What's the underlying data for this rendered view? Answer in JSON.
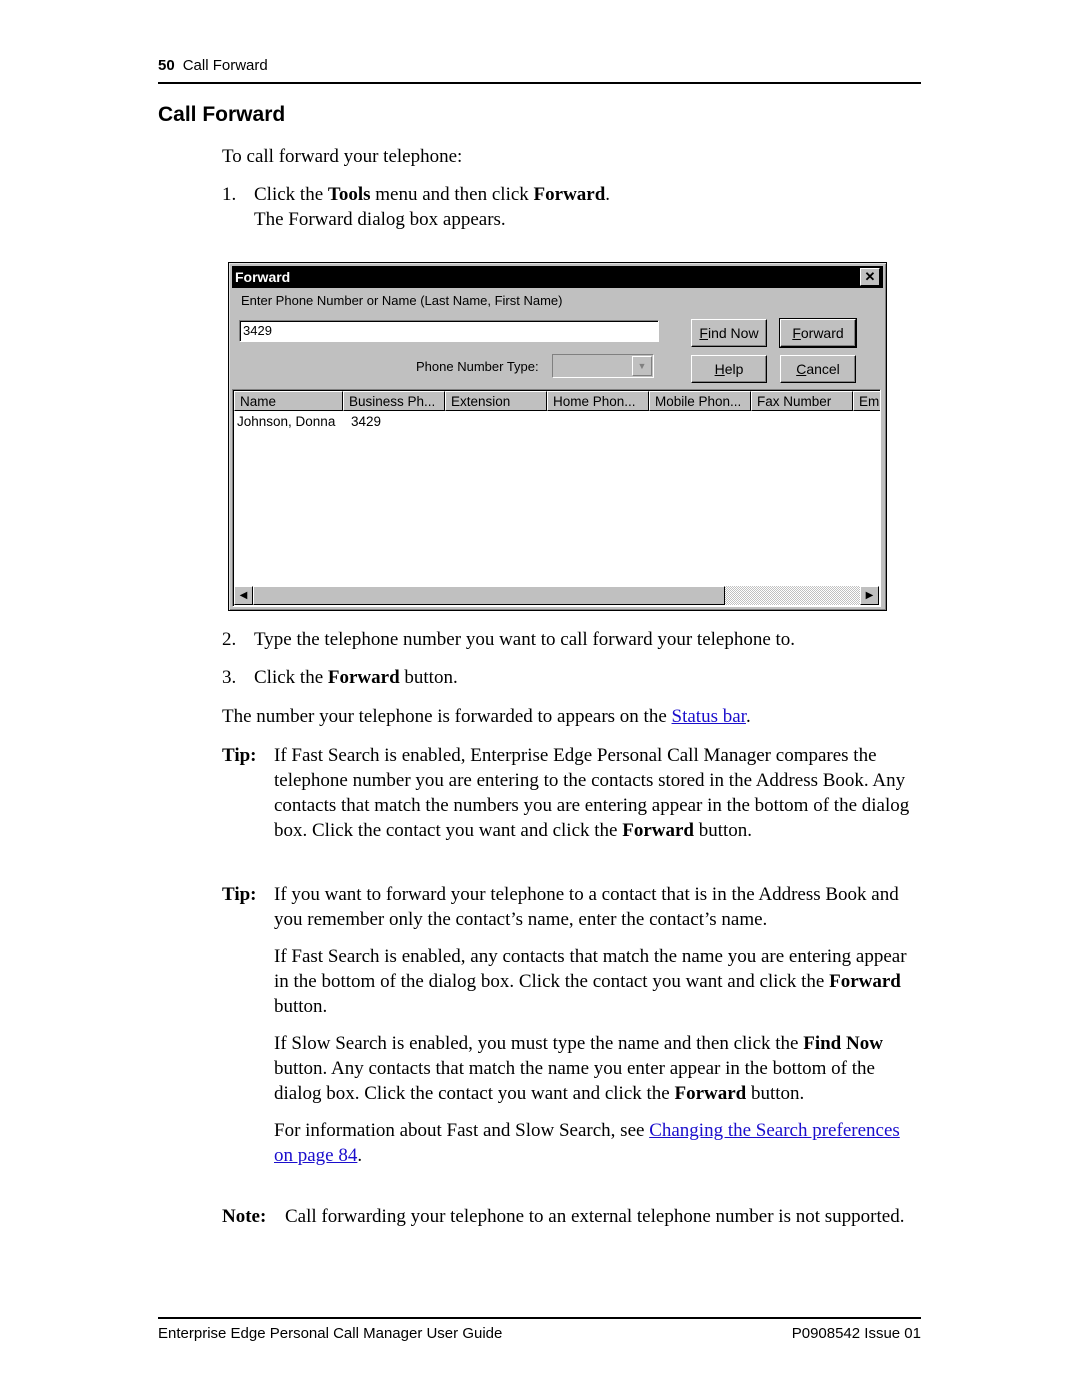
{
  "header": {
    "page_number": "50",
    "section": "Call Forward"
  },
  "title": "Call Forward",
  "intro": "To call forward your telephone:",
  "steps": [
    {
      "num": "1.",
      "pre": "Click the ",
      "b1": "Tools",
      "mid": " menu and then click ",
      "b2": "Forward",
      "post": ".",
      "sub": "The Forward dialog box appears."
    },
    {
      "num": "2.",
      "text": "Type the telephone number you want to call forward your telephone to."
    },
    {
      "num": "3.",
      "pre": "Click the ",
      "b1": "Forward",
      "post": " button."
    }
  ],
  "status_line": {
    "pre": "The number your telephone is forwarded to appears on the ",
    "link": "Status bar",
    "post": "."
  },
  "dialog": {
    "title": "Forward",
    "close_glyph": "✕",
    "input_label": "Enter Phone Number or Name (Last Name, First Name)",
    "input_value": "3429",
    "phone_type_label": "Phone Number Type:",
    "phone_type_value": "",
    "buttons": {
      "find_now": {
        "u": "F",
        "rest": "ind Now"
      },
      "forward": {
        "u": "F",
        "rest": "orward"
      },
      "help": {
        "u": "H",
        "rest": "elp"
      },
      "cancel": {
        "u": "C",
        "rest": "ancel"
      }
    },
    "columns": [
      "Name",
      "Business Ph...",
      "Extension",
      "Home Phon...",
      "Mobile Phon...",
      "Fax Number",
      "Em"
    ],
    "rows": [
      {
        "name": "Johnson, Donna",
        "business": "3429"
      }
    ],
    "scroll_left": "◀",
    "scroll_right": "▶"
  },
  "tip1": {
    "label": "Tip:",
    "text": "If Fast Search is enabled, Enterprise Edge Personal Call Manager compares the telephone number you are entering to the contacts stored in the Address Book. Any contacts that match the numbers you are entering appear in the bottom of the dialog box. Click the contact you want and click the ",
    "bold": "Forward",
    "post": " button."
  },
  "tip2": {
    "label": "Tip:",
    "text": "If you want to forward your telephone to a contact that is in the Address Book and you remember only the contact’s name, enter the contact’s name.",
    "p2": {
      "pre": "If Fast Search is enabled, any contacts that match the name you are entering appear in the bottom of the dialog box. Click the contact you want and click the ",
      "bold": "Forward",
      "post": " button."
    },
    "p3": {
      "pre": "If Slow Search is enabled, you must type the name and then click the ",
      "bold": "Find Now",
      "mid": " button. Any contacts that match the name you enter appear in the bottom of the dialog box. Click the contact you want and click the ",
      "bold2": "Forward",
      "post": " button."
    },
    "p4": {
      "pre": "For information about Fast and Slow Search, see ",
      "link": "Changing the Search preferences on page 84",
      "post": "."
    }
  },
  "note": {
    "label": "Note:",
    "text": "Call forwarding your telephone to an external telephone number is not supported."
  },
  "footer": {
    "left": "Enterprise Edge Personal Call Manager User Guide",
    "right": "P0908542 Issue 01"
  }
}
